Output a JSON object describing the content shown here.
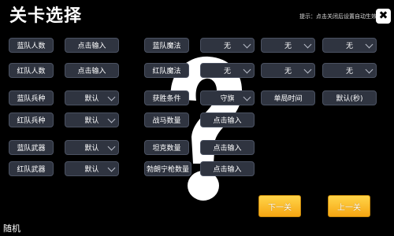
{
  "header": {
    "title": "关卡选择",
    "hint": "提示：点击关闭后设置自动生效",
    "close_label": "✖"
  },
  "left": {
    "blue_count_label": "蓝队人数",
    "blue_count_value": "点击输入",
    "red_count_label": "红队人数",
    "red_count_value": "点击输入",
    "blue_unit_label": "蓝队兵种",
    "blue_unit_value": "默认",
    "red_unit_label": "红队兵种",
    "red_unit_value": "默认",
    "blue_weapon_label": "蓝队武器",
    "blue_weapon_value": "默认",
    "red_weapon_label": "红队武器",
    "red_weapon_value": "默认"
  },
  "right": {
    "blue_magic_label": "蓝队魔法",
    "blue_magic_values": [
      "无",
      "无",
      "无"
    ],
    "red_magic_label": "红队魔法",
    "red_magic_values": [
      "无",
      "无",
      "无"
    ],
    "win_condition_label": "获胜条件",
    "win_condition_value": "守旗",
    "round_time_label": "单局时间",
    "round_time_value": "默认(秒)",
    "warhorse_label": "战马数量",
    "warhorse_value": "点击输入",
    "tank_label": "坦克数量",
    "tank_value": "点击输入",
    "browning_label": "勃朗宁枪数量",
    "browning_value": "点击输入"
  },
  "footer": {
    "next_label": "下一关",
    "prev_label": "上一关",
    "random_label": "随机"
  },
  "colors": {
    "background": "#000000",
    "field": "#2f3440",
    "button_gold": "#f6a613"
  }
}
